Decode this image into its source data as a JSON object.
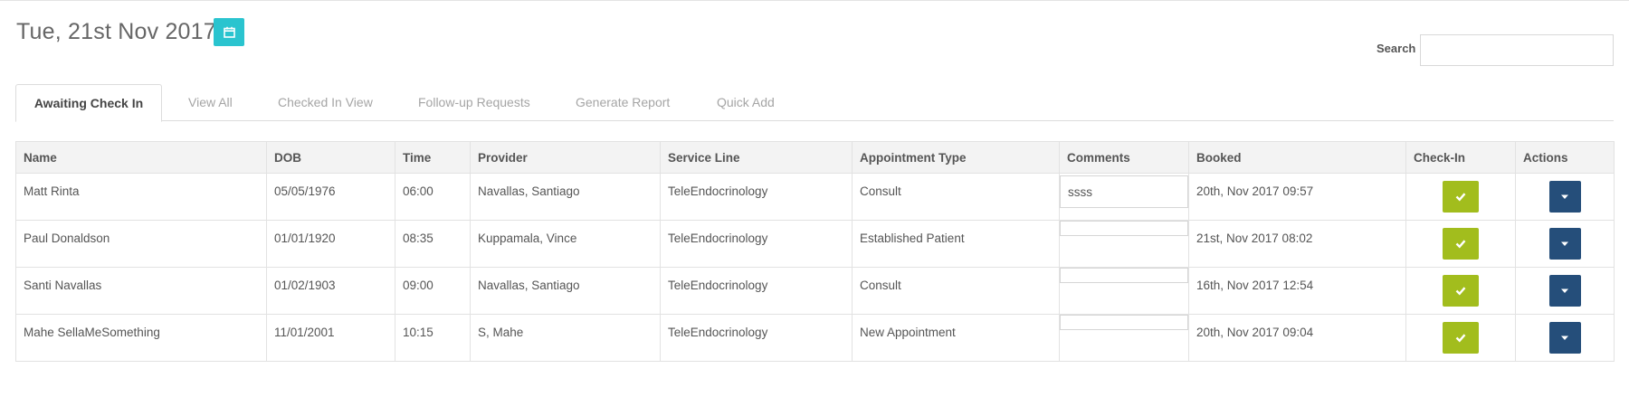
{
  "header": {
    "date_title": "Tue, 21st Nov 2017",
    "calendar_icon": "calendar-icon"
  },
  "search": {
    "label": "Search",
    "value": "",
    "placeholder": ""
  },
  "tabs": [
    {
      "label": "Awaiting Check In",
      "active": true
    },
    {
      "label": "View All",
      "active": false
    },
    {
      "label": "Checked In View",
      "active": false
    },
    {
      "label": "Follow-up Requests",
      "active": false
    },
    {
      "label": "Generate Report",
      "active": false
    },
    {
      "label": "Quick Add",
      "active": false
    }
  ],
  "table": {
    "columns": [
      "Name",
      "DOB",
      "Time",
      "Provider",
      "Service Line",
      "Appointment Type",
      "Comments",
      "Booked",
      "Check-In",
      "Actions"
    ],
    "rows": [
      {
        "name": "Matt Rinta",
        "dob": "05/05/1976",
        "time": "06:00",
        "provider": "Navallas, Santiago",
        "service_line": "TeleEndocrinology",
        "appointment_type": "Consult",
        "comments": "ssss",
        "booked": "20th, Nov 2017 09:57"
      },
      {
        "name": "Paul Donaldson",
        "dob": "01/01/1920",
        "time": "08:35",
        "provider": "Kuppamala, Vince",
        "service_line": "TeleEndocrinology",
        "appointment_type": "Established Patient",
        "comments": "",
        "booked": "21st, Nov 2017 08:02"
      },
      {
        "name": "Santi Navallas",
        "dob": "01/02/1903",
        "time": "09:00",
        "provider": "Navallas, Santiago",
        "service_line": "TeleEndocrinology",
        "appointment_type": "Consult",
        "comments": "",
        "booked": "16th, Nov 2017 12:54"
      },
      {
        "name": "Mahe SellaMeSomething",
        "dob": "11/01/2001",
        "time": "10:15",
        "provider": "S, Mahe",
        "service_line": "TeleEndocrinology",
        "appointment_type": "New Appointment",
        "comments": "",
        "booked": "20th, Nov 2017 09:04"
      }
    ]
  },
  "icons": {
    "check_in": "check-icon",
    "actions": "caret-down-icon"
  },
  "colors": {
    "calendar_button": "#2ac4cf",
    "check_in_button": "#a2bd1d",
    "action_button": "#254e7a"
  }
}
